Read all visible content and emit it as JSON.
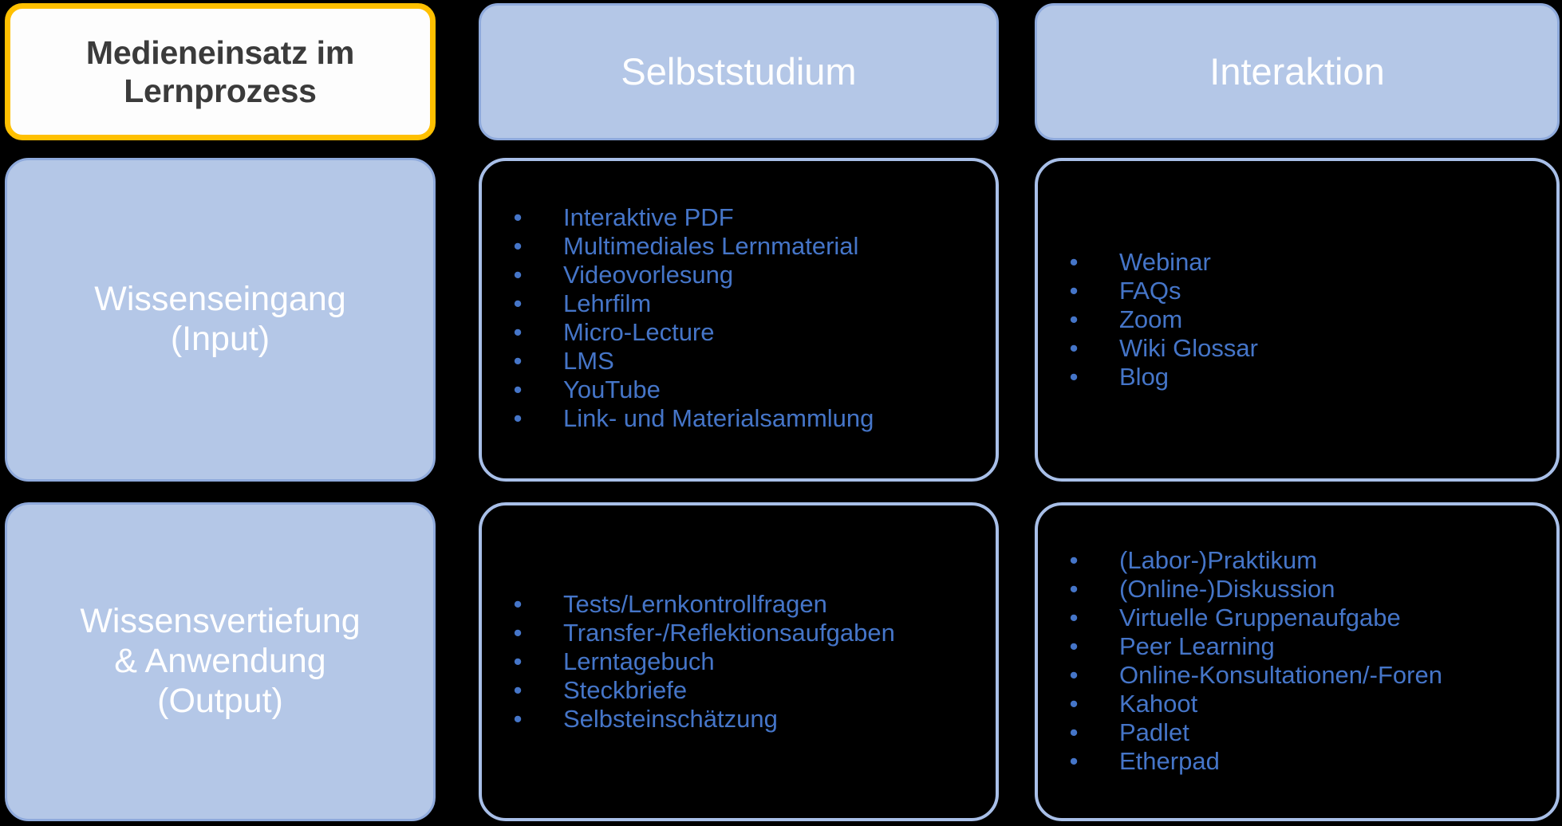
{
  "title": {
    "text": "Medieneinsatz im\nLernprozess",
    "border_color": "#FFC000",
    "text_color": "#3B3B3B",
    "background": "#FDFDFD"
  },
  "theme": {
    "blue_fill": "#B4C7E7",
    "blue_border": "#8FAADC",
    "cell_border": "#A8BFE8",
    "list_text": "#4575C8",
    "header_text": "#FFFFFF",
    "canvas_background": "#000000",
    "bullet_glyph": "•"
  },
  "columns": [
    {
      "id": "selbststudium",
      "label": "Selbststudium"
    },
    {
      "id": "interaktion",
      "label": "Interaktion"
    }
  ],
  "rows": [
    {
      "id": "input",
      "label": "Wissenseingang\n(Input)"
    },
    {
      "id": "output",
      "label": "Wissensvertiefung\n& Anwendung\n(Output)"
    }
  ],
  "cells": {
    "input_selbststudium": {
      "items": [
        "Interaktive PDF",
        "Multimediales Lernmaterial",
        "Videovorlesung",
        "Lehrfilm",
        "Micro-Lecture",
        "LMS",
        "YouTube",
        "Link- und Materialsammlung"
      ]
    },
    "input_interaktion": {
      "items": [
        "Webinar",
        "FAQs",
        "Zoom",
        "Wiki Glossar",
        "Blog"
      ]
    },
    "output_selbststudium": {
      "items": [
        "Tests/Lernkontrollfragen",
        "Transfer-/Reflektionsaufgaben",
        "Lerntagebuch",
        "Steckbriefe",
        "Selbsteinschätzung"
      ]
    },
    "output_interaktion": {
      "items": [
        "(Labor-)Praktikum",
        "(Online-)Diskussion",
        "Virtuelle Gruppenaufgabe",
        "Peer Learning",
        "Online-Konsultationen/-Foren",
        "Kahoot",
        "Padlet",
        "Etherpad"
      ]
    }
  }
}
